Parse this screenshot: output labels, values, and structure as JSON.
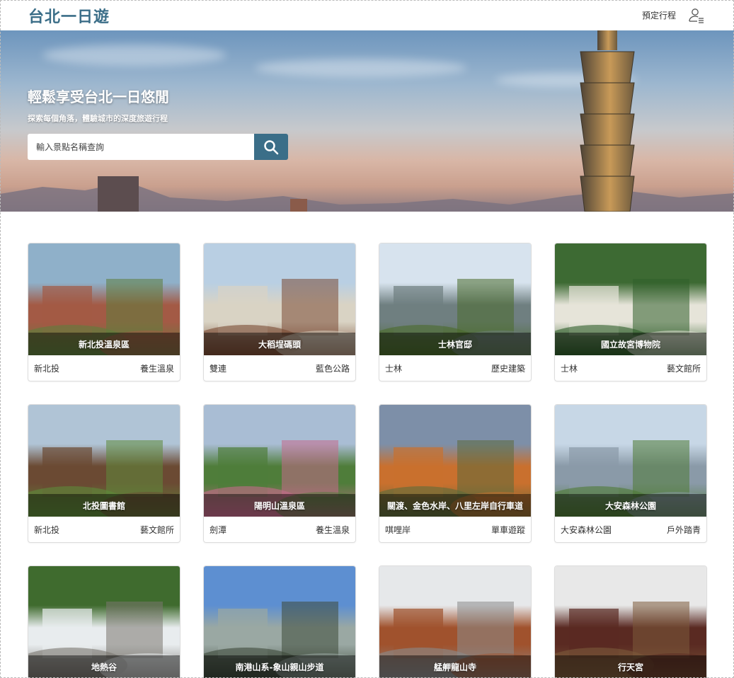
{
  "header": {
    "logo": "台北一日遊",
    "nav_link": "預定行程",
    "user_icon": "user-list-icon"
  },
  "hero": {
    "title": "輕鬆享受台北一日悠閒",
    "subtitle": "探索每個角落，體驗城市的深度旅遊行程",
    "search_placeholder": "輸入景點名稱查詢",
    "search_icon": "search-icon"
  },
  "attractions": [
    {
      "name": "新北投溫泉區",
      "mrt": "新北投",
      "category": "養生溫泉",
      "palette": [
        "#8fb0c9",
        "#a35a45",
        "#5f7d3c"
      ]
    },
    {
      "name": "大稻埕碼頭",
      "mrt": "雙連",
      "category": "藍色公路",
      "palette": [
        "#b9cfe3",
        "#d9d3c4",
        "#7a4b34"
      ]
    },
    {
      "name": "士林官邸",
      "mrt": "士林",
      "category": "歷史建築",
      "palette": [
        "#d7e3ee",
        "#6f7f80",
        "#4b6b2c"
      ]
    },
    {
      "name": "國立故宮博物院",
      "mrt": "士林",
      "category": "藝文館所",
      "palette": [
        "#3d6a33",
        "#e6e4d9",
        "#2f5e2a"
      ]
    },
    {
      "name": "北投圖書館",
      "mrt": "新北投",
      "category": "藝文館所",
      "palette": [
        "#b0c4d6",
        "#6b4a33",
        "#5e8b3a"
      ]
    },
    {
      "name": "陽明山溫泉區",
      "mrt": "劍潭",
      "category": "養生溫泉",
      "palette": [
        "#a9bdd4",
        "#4f7d3a",
        "#c46a8a"
      ]
    },
    {
      "name": "關渡、金色水岸、八里左岸自行車道",
      "mrt": "唭哩岸",
      "category": "單車遊蹤",
      "palette": [
        "#7d8fa8",
        "#c9702e",
        "#5d6a3a"
      ]
    },
    {
      "name": "大安森林公園",
      "mrt": "大安森林公園",
      "category": "戶外踏青",
      "palette": [
        "#c7d7e6",
        "#8a9aa8",
        "#4f7a35"
      ]
    },
    {
      "name": "地熱谷",
      "mrt": "",
      "category": "",
      "palette": [
        "#3f6b2e",
        "#e8ecee",
        "#7a7670"
      ]
    },
    {
      "name": "南港山系-象山親山步道",
      "mrt": "",
      "category": "",
      "palette": [
        "#5d8fd1",
        "#9aa8a3",
        "#3e4a3a"
      ]
    },
    {
      "name": "艋舺龍山寺",
      "mrt": "",
      "category": "",
      "palette": [
        "#e6e8ea",
        "#a0522d",
        "#8a8a8a"
      ]
    },
    {
      "name": "行天宮",
      "mrt": "",
      "category": "",
      "palette": [
        "#e8e8e8",
        "#5a2a22",
        "#7b5a3a"
      ]
    }
  ]
}
